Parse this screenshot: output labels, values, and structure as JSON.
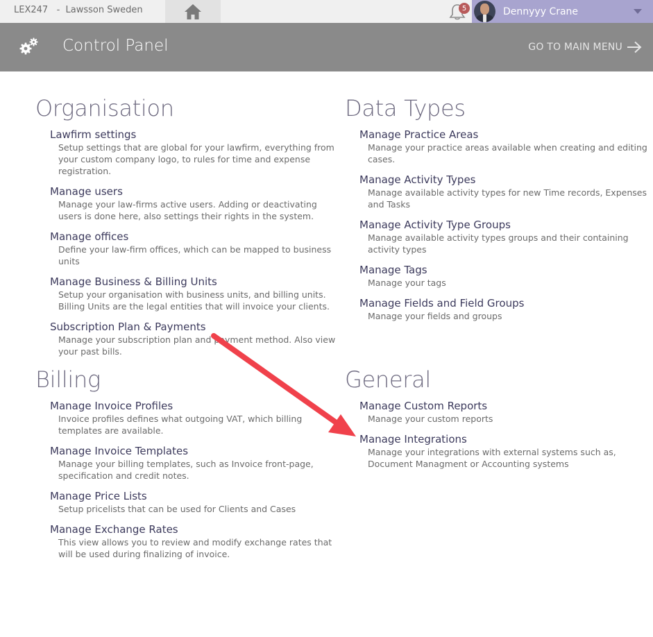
{
  "topbar": {
    "app_name": "LEX247   -  Lawsson Sweden",
    "notification_count": "5",
    "user_name": "Dennyyy Crane"
  },
  "header": {
    "title": "Control Panel",
    "main_menu_label": "GO TO MAIN MENU"
  },
  "sections": {
    "organisation": {
      "title": "Organisation",
      "items": [
        {
          "title": "Lawfirm settings",
          "desc": "Setup settings that are global for your lawfirm, everything from your custom company logo, to rules for time and expense registration."
        },
        {
          "title": "Manage users",
          "desc": "Manage your law-firms active users. Adding or deactivating users is done here, also settings their rights in the system."
        },
        {
          "title": "Manage offices",
          "desc": "Define your law-firm offices, which can be mapped to business units"
        },
        {
          "title": "Manage Business & Billing Units",
          "desc": "Setup your organisation with business units, and billing units. Billing Units are the legal entities that will invoice your clients."
        },
        {
          "title": "Subscription Plan & Payments",
          "desc": "Manage your subscription plan and payment method. Also view your past bills."
        }
      ]
    },
    "data_types": {
      "title": "Data Types",
      "items": [
        {
          "title": "Manage Practice Areas",
          "desc": "Manage your practice areas available when creating and editing cases."
        },
        {
          "title": "Manage Activity Types",
          "desc": "Manage available activity types for new Time records, Expenses and Tasks"
        },
        {
          "title": "Manage Activity Type Groups",
          "desc": "Manage available activity types groups and their containing activity types"
        },
        {
          "title": "Manage Tags",
          "desc": "Manage your tags"
        },
        {
          "title": "Manage Fields and Field Groups",
          "desc": "Manage your fields and groups"
        }
      ]
    },
    "billing": {
      "title": "Billing",
      "items": [
        {
          "title": "Manage Invoice Profiles",
          "desc": "Invoice profiles defines what outgoing VAT, which billing templates are available."
        },
        {
          "title": "Manage Invoice Templates",
          "desc": "Manage your billing templates, such as Invoice front-page, specification and credit notes."
        },
        {
          "title": "Manage Price Lists",
          "desc": "Setup pricelists that can be used for Clients and Cases"
        },
        {
          "title": "Manage Exchange Rates",
          "desc": "This view allows you to review and modify exchange rates that will be used during finalizing of invoice."
        }
      ]
    },
    "general": {
      "title": "General",
      "items": [
        {
          "title": "Manage Custom Reports",
          "desc": "Manage your custom reports"
        },
        {
          "title": "Manage Integrations",
          "desc": "Manage your integrations with external systems such as, Document Managment or Accounting systems"
        }
      ]
    }
  },
  "colors": {
    "header_bg": "#8a8a8a",
    "user_area_bg": "#a8a4cf",
    "annotation_arrow": "#f0414b"
  }
}
